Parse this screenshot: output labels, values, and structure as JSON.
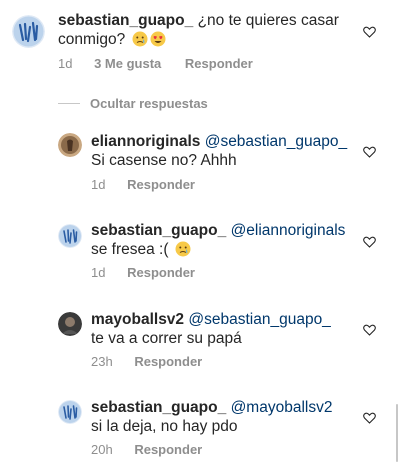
{
  "comments": [
    {
      "username": "sebastian_guapo_",
      "text_line1": "¿no te quieres casar",
      "text_line2": "conmigo?",
      "emoji": "crying-face 😢, heart-eyes 😍",
      "time": "1d",
      "likes": "3 Me gusta",
      "reply": "Responder"
    }
  ],
  "hide_replies_label": "Ocultar respuestas",
  "replies": [
    {
      "username": "eliannoriginals",
      "mention": "@sebastian_guapo_",
      "text": "Si casense no? Ahhh",
      "time": "1d",
      "reply": "Responder"
    },
    {
      "username": "sebastian_guapo_",
      "mention": "@eliannoriginals",
      "text": "se fresea :(",
      "emoji": "crying-face 😢",
      "time": "1d",
      "reply": "Responder"
    },
    {
      "username": "mayoballsv2",
      "mention": "@sebastian_guapo_",
      "text": "te va a correr su papá",
      "time": "23h",
      "reply": "Responder"
    },
    {
      "username": "sebastian_guapo_",
      "mention": "@mayoballsv2",
      "text": "si la deja, no hay pdo",
      "time": "20h",
      "reply": "Responder"
    }
  ],
  "colors": {
    "text": "#262626",
    "meta": "#8e8e8e",
    "mention": "#00376b",
    "divider": "#c7c7c7"
  },
  "icons": {
    "like": "heart-outline-icon",
    "avatar_main": "profile-avatar"
  }
}
